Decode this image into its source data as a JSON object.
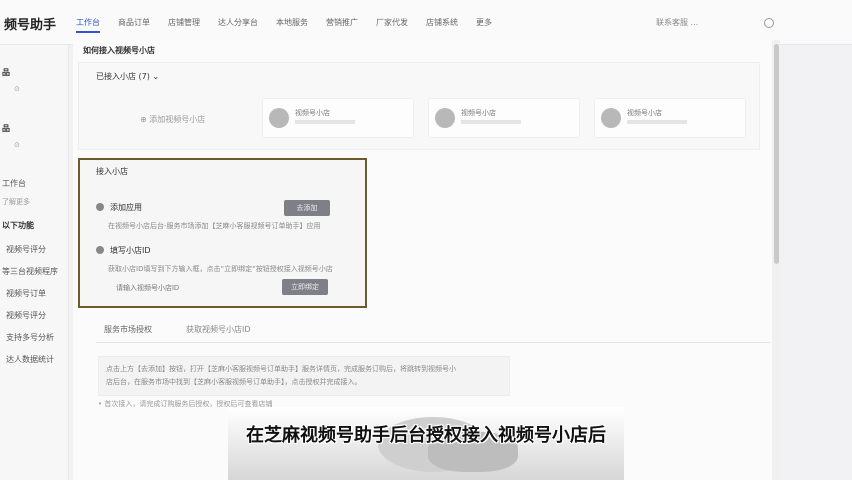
{
  "app": {
    "brand": "频号助手"
  },
  "nav": {
    "items": [
      {
        "label": "工作台",
        "active": true
      },
      {
        "label": "商品订单"
      },
      {
        "label": "店铺管理"
      },
      {
        "label": "达人分享台"
      },
      {
        "label": "本地服务"
      },
      {
        "label": "营销推广"
      },
      {
        "label": "厂家代发"
      },
      {
        "label": "店铺系统"
      },
      {
        "label": "更多"
      }
    ],
    "user": "联系客服 ..."
  },
  "sidebar": {
    "items": [
      {
        "label": "品"
      },
      {
        "label": "⊙"
      },
      {
        "label": "品"
      },
      {
        "label": "⊙"
      },
      {
        "label": "工作台"
      },
      {
        "label": "了解更多"
      },
      {
        "label": "以下功能"
      },
      {
        "label": "视频号评分"
      },
      {
        "label": "等三台视频程序"
      },
      {
        "label": "视频号订单"
      },
      {
        "label": "视频号评分"
      },
      {
        "label": "支持多号分析"
      },
      {
        "label": "达人数据统计"
      }
    ]
  },
  "main": {
    "section_title": "如何接入视频号小店",
    "shop_count": "已接入小店 (7) ⌄",
    "add_store": "⊕ 添加视频号小店",
    "stores": [
      {
        "name": "视频号小店"
      },
      {
        "name": "视频号小店"
      },
      {
        "name": "视频号小店"
      }
    ]
  },
  "connect": {
    "title": "接入小店",
    "step1_label": "添加应用",
    "step1_desc": "在视频号小店后台-服务市场添加【芝麻小客服视频号订单助手】应用",
    "step1_button": "去添加",
    "step2_label": "填写小店ID",
    "step2_desc": "获取小店ID填写到下方输入框，点击“立即绑定”按钮授权接入视频号小店",
    "input_placeholder": "请输入视频号小店ID",
    "step2_button": "立即绑定"
  },
  "tabs": [
    {
      "label": "服务市场授权",
      "active": true
    },
    {
      "label": "获取视频号小店ID"
    }
  ],
  "tip": {
    "line1": "点击上方【去添加】按钮，打开【芝麻小客服视频号订单助手】服务详情页，完成服务订购后，将跳转到视频号小",
    "line2": "店后台，在服务市场中找到【芝麻小客服视频号订单助手】，点击授权并完成接入。"
  },
  "partial_text": "• 首次接入，请完成订购服务后授权，授权后可查看店铺",
  "subtitle": "在芝麻视频号助手后台授权接入视频号小店后"
}
